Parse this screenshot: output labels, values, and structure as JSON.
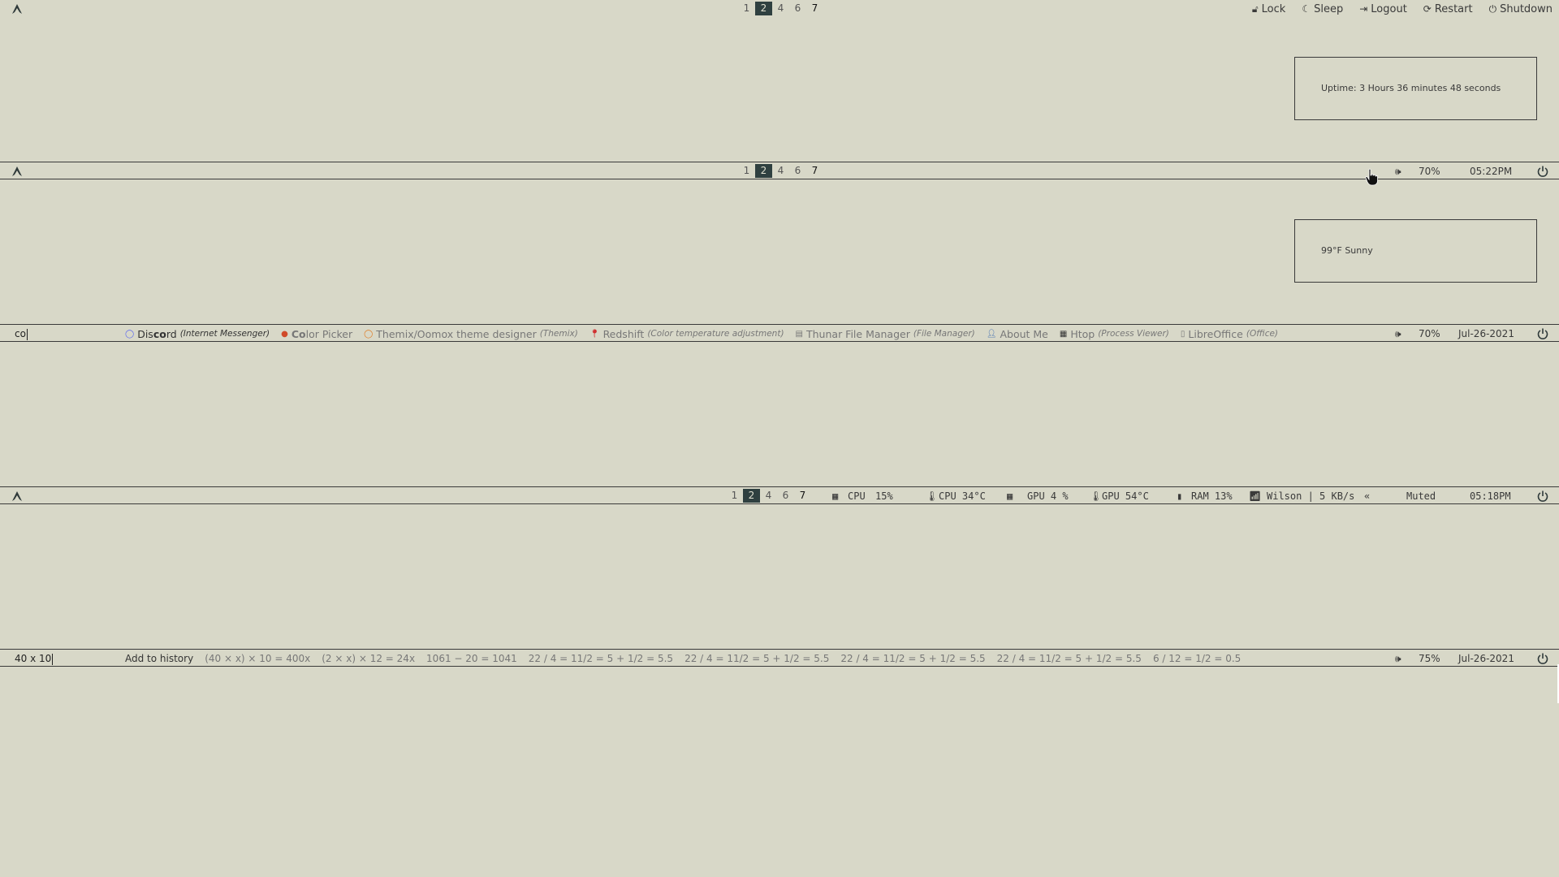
{
  "workspaces": [
    {
      "label": "1",
      "state": "normal"
    },
    {
      "label": "2",
      "state": "active"
    },
    {
      "label": "4",
      "state": "normal"
    },
    {
      "label": "6",
      "state": "normal"
    },
    {
      "label": "7",
      "state": "occupied"
    }
  ],
  "power_menu": [
    {
      "icon": "lock-icon",
      "label": "Lock"
    },
    {
      "icon": "moon-icon",
      "label": "Sleep"
    },
    {
      "icon": "logout-icon",
      "label": "Logout"
    },
    {
      "icon": "restart-icon",
      "label": "Restart"
    },
    {
      "icon": "power-icon",
      "label": "Shutdown"
    }
  ],
  "uptime_popup": {
    "text": "Uptime: 3 Hours 36 minutes 48 seconds"
  },
  "bar2": {
    "volume": "70%",
    "time": "05:22PM"
  },
  "weather_popup": {
    "text": "99°F Sunny"
  },
  "bar3": {
    "query": "co",
    "volume": "70%",
    "date": "Jul-26-2021",
    "results": [
      {
        "icon": "discord-icon",
        "pre": "Dis",
        "match": "co",
        "post": "rd",
        "desc": "(Internet Messenger)",
        "selected": true
      },
      {
        "icon": "color-picker-icon",
        "pre": "",
        "match": "Co",
        "post": "lor Picker",
        "desc": "",
        "selected": false
      },
      {
        "icon": "themix-icon",
        "pre": "",
        "match": "",
        "post": "Themix/Oomox theme designer",
        "desc": "(Themix)",
        "selected": false
      },
      {
        "icon": "redshift-icon",
        "pre": "",
        "match": "",
        "post": "Redshift",
        "desc": "(Color temperature adjustment)",
        "selected": false
      },
      {
        "icon": "folder-icon",
        "pre": "",
        "match": "",
        "post": "Thunar File Manager",
        "desc": "(File Manager)",
        "selected": false
      },
      {
        "icon": "user-icon",
        "pre": "",
        "match": "",
        "post": "About Me",
        "desc": "",
        "selected": false
      },
      {
        "icon": "htop-icon",
        "pre": "",
        "match": "",
        "post": "Htop",
        "desc": "(Process Viewer)",
        "selected": false
      },
      {
        "icon": "document-icon",
        "pre": "",
        "match": "",
        "post": "LibreOffice",
        "desc": "(Office)",
        "selected": false
      }
    ]
  },
  "bar4": {
    "cpu_label": "CPU",
    "cpu_value": "15%",
    "cpu_temp": "CPU 34°C",
    "gpu": "GPU 4 %",
    "gpu_temp": "GPU 54°C",
    "ram": "RAM 13%",
    "network": "Wilson | 5 KB/s",
    "collapse": "«",
    "volume": "Muted",
    "time": "05:18PM"
  },
  "bar5": {
    "query": "40 x 10",
    "add_history": "Add to history",
    "volume": "75%",
    "date": "Jul-26-2021",
    "calcs": [
      "(40 × x) × 10 = 400x",
      "(2 × x) × 12 = 24x",
      "1061 − 20 = 1041",
      "22 / 4 = 11/2 = 5 + 1/2 = 5.5",
      "22 / 4 = 11/2 = 5 + 1/2 = 5.5",
      "22 / 4 = 11/2 = 5 + 1/2 = 5.5",
      "22 / 4 = 11/2 = 5 + 1/2 = 5.5",
      "6 / 12 = 1/2 = 0.5"
    ]
  }
}
